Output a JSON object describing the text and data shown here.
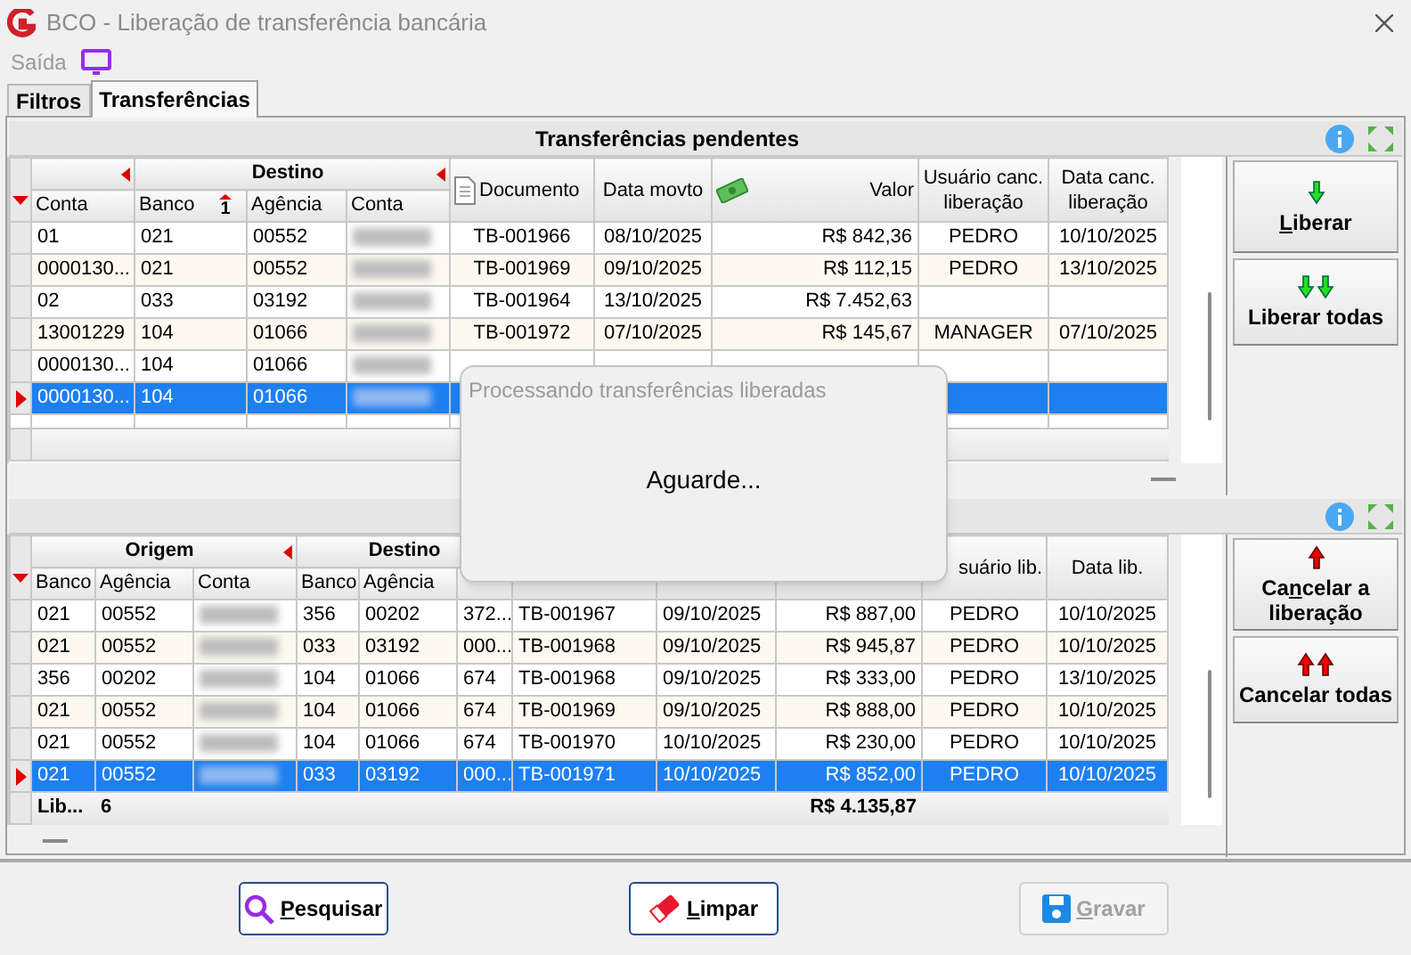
{
  "window": {
    "title": "BCO - Liberação de transferência bancária"
  },
  "menu": [
    {
      "label": "Saída",
      "disabled": true
    }
  ],
  "tabs": [
    {
      "label": "Filtros",
      "selected": false
    },
    {
      "label": "Transferências",
      "selected": true
    }
  ],
  "pending": {
    "title": "Transferências pendentes",
    "header": [
      {
        "kind": "group",
        "collapsible": true,
        "columns": [
          {
            "label": "Conta"
          }
        ]
      },
      {
        "kind": "group",
        "label": "Destino",
        "collapsible": true,
        "columns": [
          {
            "label": "Banco",
            "sort": "1"
          },
          {
            "label": "Agência"
          },
          {
            "label": "Conta"
          }
        ]
      },
      {
        "kind": "document",
        "label": "Documento"
      },
      {
        "kind": "plain",
        "label": "Data movto"
      },
      {
        "kind": "amount",
        "label": "Valor"
      },
      {
        "kind": "plain",
        "label": "Usuário canc. liberação"
      },
      {
        "kind": "plain",
        "label": "Data canc. liberação"
      }
    ],
    "rows": [
      {
        "selected": false,
        "cells": [
          "01",
          "021",
          "00552",
          {
            "redacted": true
          },
          "TB-001966",
          "08/10/2025",
          "R$ 842,36",
          "PEDRO",
          "10/10/2025"
        ]
      },
      {
        "selected": false,
        "cells": [
          "0000130...",
          "021",
          "00552",
          {
            "redacted": true
          },
          "TB-001969",
          "09/10/2025",
          "R$ 112,15",
          "PEDRO",
          "13/10/2025"
        ]
      },
      {
        "selected": false,
        "cells": [
          "02",
          "033",
          "03192",
          {
            "redacted": true
          },
          "TB-001964",
          "13/10/2025",
          "R$ 7.452,63",
          null,
          null
        ]
      },
      {
        "selected": false,
        "cells": [
          "13001229",
          "104",
          "01066",
          {
            "redacted": true
          },
          "TB-001972",
          "07/10/2025",
          "R$ 145,67",
          "MANAGER",
          "07/10/2025"
        ]
      },
      {
        "selected": false,
        "cells": [
          "0000130...",
          "104",
          "01066",
          {
            "redacted": true
          },
          null,
          null,
          null,
          null,
          null
        ]
      },
      {
        "selected": true,
        "cells": [
          "0000130...",
          "104",
          "01066",
          {
            "redacted": true
          },
          null,
          null,
          null,
          null,
          null
        ]
      }
    ],
    "buttons": [
      {
        "kind": "single",
        "accel": "L",
        "rest": "iberar"
      },
      {
        "kind": "all",
        "label": "Liberar todas"
      }
    ]
  },
  "released": {
    "header": [
      {
        "kind": "group",
        "label": "Origem",
        "collapsible": true,
        "columns": [
          {
            "label": "Banco"
          },
          {
            "label": "Agência"
          },
          {
            "label": "Conta"
          }
        ]
      },
      {
        "kind": "group",
        "label": "Destino",
        "collapsible": false,
        "columns": [
          {
            "label": "Banco"
          },
          {
            "label": "Agência"
          },
          {}
        ]
      },
      {
        "kind": "plain"
      },
      {
        "kind": "plain"
      },
      {
        "kind": "plain"
      },
      {
        "kind": "plain",
        "label": "suário lib."
      },
      {
        "kind": "plain",
        "label": "Data lib."
      }
    ],
    "rows": [
      {
        "selected": false,
        "cells": [
          "021",
          "00552",
          {
            "redacted": true
          },
          "356",
          "00202",
          "372...",
          "TB-001967",
          "09/10/2025",
          "R$ 887,00",
          "PEDRO",
          "10/10/2025"
        ]
      },
      {
        "selected": false,
        "cells": [
          "021",
          "00552",
          {
            "redacted": true
          },
          "033",
          "03192",
          "000...",
          "TB-001968",
          "09/10/2025",
          "R$ 945,87",
          "PEDRO",
          "10/10/2025"
        ]
      },
      {
        "selected": false,
        "cells": [
          "356",
          "00202",
          {
            "redacted": true
          },
          "104",
          "01066",
          "674",
          "TB-001968",
          "09/10/2025",
          "R$ 333,00",
          "PEDRO",
          "13/10/2025"
        ]
      },
      {
        "selected": false,
        "cells": [
          "021",
          "00552",
          {
            "redacted": true
          },
          "104",
          "01066",
          "674",
          "TB-001969",
          "09/10/2025",
          "R$ 888,00",
          "PEDRO",
          "10/10/2025"
        ]
      },
      {
        "selected": false,
        "cells": [
          "021",
          "00552",
          {
            "redacted": true
          },
          "104",
          "01066",
          "674",
          "TB-001970",
          "10/10/2025",
          "R$ 230,00",
          "PEDRO",
          "10/10/2025"
        ]
      },
      {
        "selected": true,
        "cells": [
          "021",
          "00552",
          {
            "redacted": true
          },
          "033",
          "03192",
          "000...",
          "TB-001971",
          "10/10/2025",
          "R$ 852,00",
          "PEDRO",
          "10/10/2025"
        ]
      }
    ],
    "footer": {
      "label": "Lib...",
      "count": "6",
      "total": "R$ 4.135,87"
    },
    "buttons": [
      {
        "kind": "single",
        "pre": "Ca",
        "accel": "n",
        "rest": "celar a liberação"
      },
      {
        "kind": "all",
        "label": "Cancelar todas"
      }
    ]
  },
  "dialog": {
    "title": "Processando transferências liberadas",
    "message": "Aguarde..."
  },
  "actions": [
    {
      "kind": "search",
      "accel": "P",
      "rest": "esquisar",
      "disabled": false
    },
    {
      "kind": "clear",
      "accel": "L",
      "rest": "impar",
      "disabled": false
    },
    {
      "kind": "save",
      "accel": "G",
      "rest": "ravar",
      "disabled": true
    }
  ]
}
